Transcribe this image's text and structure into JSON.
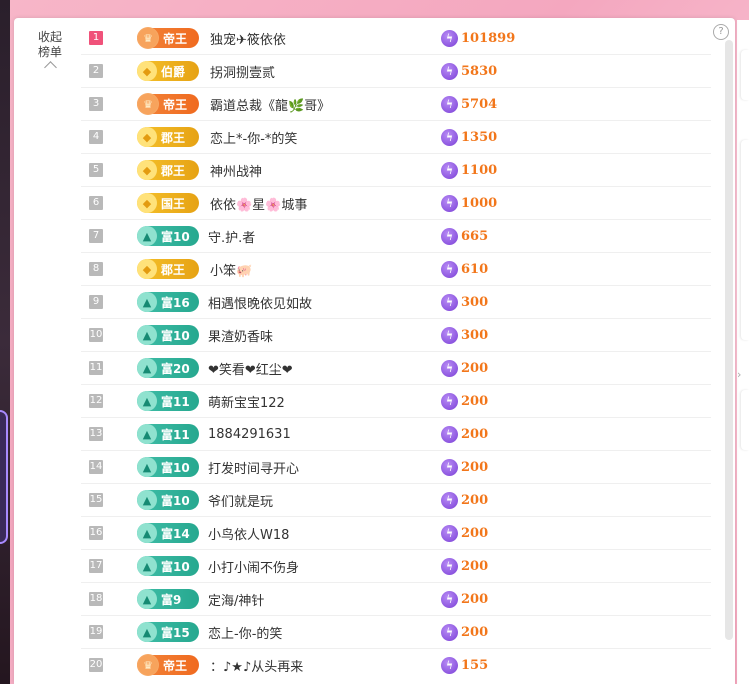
{
  "panel": {
    "collapse_line1": "收起",
    "collapse_line2": "榜单",
    "help_glyph": "?"
  },
  "colors": {
    "rank_top": "#f0527a",
    "rank_default": "#b9b9b9",
    "score": "#f2761a",
    "badge_emperor": "#f06a1f",
    "badge_gold": "#e6a214",
    "badge_teal": "#26a88f"
  },
  "rows": [
    {
      "rank": "1",
      "badge": "帝王",
      "badge_style": "emperor",
      "name": "独宠✈筱依依",
      "score": "101899"
    },
    {
      "rank": "2",
      "badge": "伯爵",
      "badge_style": "gold",
      "name": "拐洞捌壹贰",
      "score": "5830"
    },
    {
      "rank": "3",
      "badge": "帝王",
      "badge_style": "emperor",
      "name": "霸道总裁《龍🌿哥》",
      "score": "5704"
    },
    {
      "rank": "4",
      "badge": "郡王",
      "badge_style": "gold",
      "name": "恋上*-你-*的笑",
      "score": "1350"
    },
    {
      "rank": "5",
      "badge": "郡王",
      "badge_style": "gold",
      "name": "神州战神",
      "score": "1100"
    },
    {
      "rank": "6",
      "badge": "国王",
      "badge_style": "gold",
      "name": "依依🌸星🌸城事",
      "score": "1000"
    },
    {
      "rank": "7",
      "badge": "富10",
      "badge_style": "teal",
      "name": "守.护.者",
      "score": "665"
    },
    {
      "rank": "8",
      "badge": "郡王",
      "badge_style": "gold",
      "name": "小笨🐖",
      "score": "610"
    },
    {
      "rank": "9",
      "badge": "富16",
      "badge_style": "teal",
      "name": "相遇恨晚依见如故",
      "score": "300"
    },
    {
      "rank": "10",
      "badge": "富10",
      "badge_style": "teal",
      "name": "果渣奶香味",
      "score": "300"
    },
    {
      "rank": "11",
      "badge": "富20",
      "badge_style": "teal",
      "name": "❤笑看❤红尘❤",
      "score": "200"
    },
    {
      "rank": "12",
      "badge": "富11",
      "badge_style": "teal",
      "name": "萌新宝宝122",
      "score": "200"
    },
    {
      "rank": "13",
      "badge": "富11",
      "badge_style": "teal",
      "name": "1884291631",
      "score": "200"
    },
    {
      "rank": "14",
      "badge": "富10",
      "badge_style": "teal",
      "name": "打发时间寻开心",
      "score": "200"
    },
    {
      "rank": "15",
      "badge": "富10",
      "badge_style": "teal",
      "name": "爷们就是玩",
      "score": "200"
    },
    {
      "rank": "16",
      "badge": "富14",
      "badge_style": "teal",
      "name": "小鸟依人W18",
      "score": "200"
    },
    {
      "rank": "17",
      "badge": "富10",
      "badge_style": "teal",
      "name": "小打小闹不伤身",
      "score": "200"
    },
    {
      "rank": "18",
      "badge": "富9",
      "badge_style": "teal",
      "name": "定海/神针",
      "score": "200"
    },
    {
      "rank": "19",
      "badge": "富15",
      "badge_style": "teal",
      "name": "恋上-你-的笑",
      "score": "200"
    },
    {
      "rank": "20",
      "badge": "帝王",
      "badge_style": "emperor",
      "name": "：♪★♪从头再来",
      "score": "155"
    }
  ]
}
